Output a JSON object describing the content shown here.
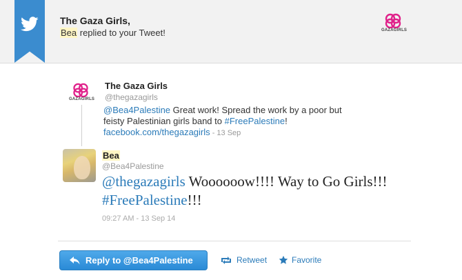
{
  "header": {
    "sender_name": "The Gaza Girls,",
    "replier": "Bea",
    "message_rest": " replied to your Tweet!",
    "logo_text": "GAZAGIRLS",
    "bird_icon": "twitter-bird-icon",
    "banner_color": "#3b8ccf"
  },
  "original_tweet": {
    "author_name": "The Gaza Girls",
    "handle": "@thegazagirls",
    "mention": "@Bea4Palestine",
    "text_part1": " Great work! Spread the work by a poor but feisty Palestinian girls band to ",
    "hashtag": "#FreePalestine",
    "text_part2": "!",
    "link": "facebook.com/thegazagirls",
    "date": " - 13 Sep",
    "logo_text": "GAZAGIRLS"
  },
  "reply_tweet": {
    "author_name": "Bea",
    "handle": "@Bea4Palestine",
    "mention": "@thegazagirls",
    "text_part1": " Woooooow!!!! Way to Go Girls!!! ",
    "hashtag": "#FreePalestine",
    "text_part2": "!!!",
    "timestamp": "09:27 AM - 13 Sep 14"
  },
  "actions": {
    "reply_label": "Reply to @Bea4Palestine",
    "retweet_label": "Retweet",
    "favorite_label": "Favorite",
    "reply_icon": "reply-arrow-icon",
    "retweet_icon": "retweet-icon",
    "favorite_icon": "star-icon",
    "accent_color": "#2b7bb9"
  }
}
